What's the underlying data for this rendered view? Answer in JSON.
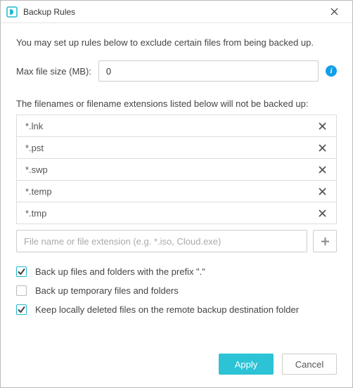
{
  "window": {
    "title": "Backup Rules"
  },
  "intro": "You may set up rules below to exclude certain files from being backed up.",
  "maxsize": {
    "label": "Max file size (MB):",
    "value": "0"
  },
  "list_label": "The filenames or filename extensions listed below will not be backed up:",
  "excludes": [
    {
      "name": "*.lnk"
    },
    {
      "name": "*.pst"
    },
    {
      "name": "*.swp"
    },
    {
      "name": "*.temp"
    },
    {
      "name": "*.tmp"
    }
  ],
  "add_placeholder": "File name or file extension (e.g. *.iso, Cloud.exe)",
  "checks": [
    {
      "label": "Back up files and folders with the prefix \".\"",
      "checked": true
    },
    {
      "label": "Back up temporary files and folders",
      "checked": false
    },
    {
      "label": "Keep locally deleted files on the remote backup destination folder",
      "checked": true
    }
  ],
  "buttons": {
    "apply": "Apply",
    "cancel": "Cancel"
  }
}
